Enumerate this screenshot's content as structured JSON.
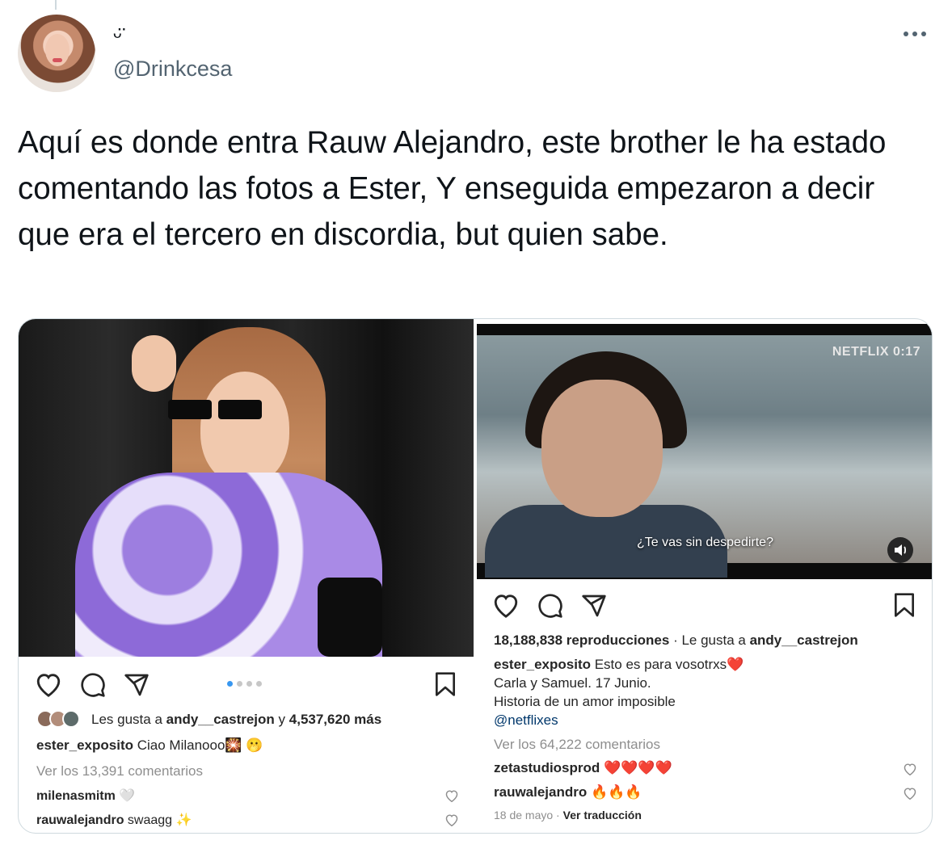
{
  "tweet": {
    "display_name": "ᵕ̈",
    "handle": "@Drinkcesa",
    "text": "Aquí es donde entra Rauw Alejandro, este brother le ha estado comentando las fotos a Ester, Y enseguida empezaron a decir que era el tercero en discordia, but quien sabe."
  },
  "left_post": {
    "likes_prefix": "Les gusta a ",
    "likes_user": "andy__castrejon",
    "likes_middle": " y ",
    "likes_count": "4,537,620 más",
    "caption_user": "ester_exposito",
    "caption_text": " Ciao Milanooo🎇 🫢",
    "view_comments": "Ver los 13,391 comentarios",
    "comments": [
      {
        "user": "milenasmitm",
        "text": " 🤍"
      },
      {
        "user": "rauwalejandro",
        "text": " swaagg ✨"
      }
    ],
    "carousel_dots": 4
  },
  "right_post": {
    "netflix": "NETFLIX",
    "timestamp": "0:17",
    "subtitle": "¿Te vas sin despedirte?",
    "views": "18,188,838 reproducciones",
    "liked_by_prefix": " · Le gusta a ",
    "liked_by_user": "andy__castrejon",
    "caption_user": "ester_exposito",
    "caption_line1": " Esto es para vosotrxs❤️",
    "caption_line2": "Carla y Samuel. 17 Junio.",
    "caption_line3": "Historia de un amor imposible",
    "caption_mention": "@netflixes",
    "view_comments": "Ver los 64,222 comentarios",
    "comments": [
      {
        "user": "zetastudiosprod",
        "text": " ❤️❤️❤️❤️"
      },
      {
        "user": "rauwalejandro",
        "text": " 🔥🔥🔥"
      }
    ],
    "date": "18 de mayo",
    "translate_prefix": " · ",
    "translate": "Ver traducción"
  }
}
